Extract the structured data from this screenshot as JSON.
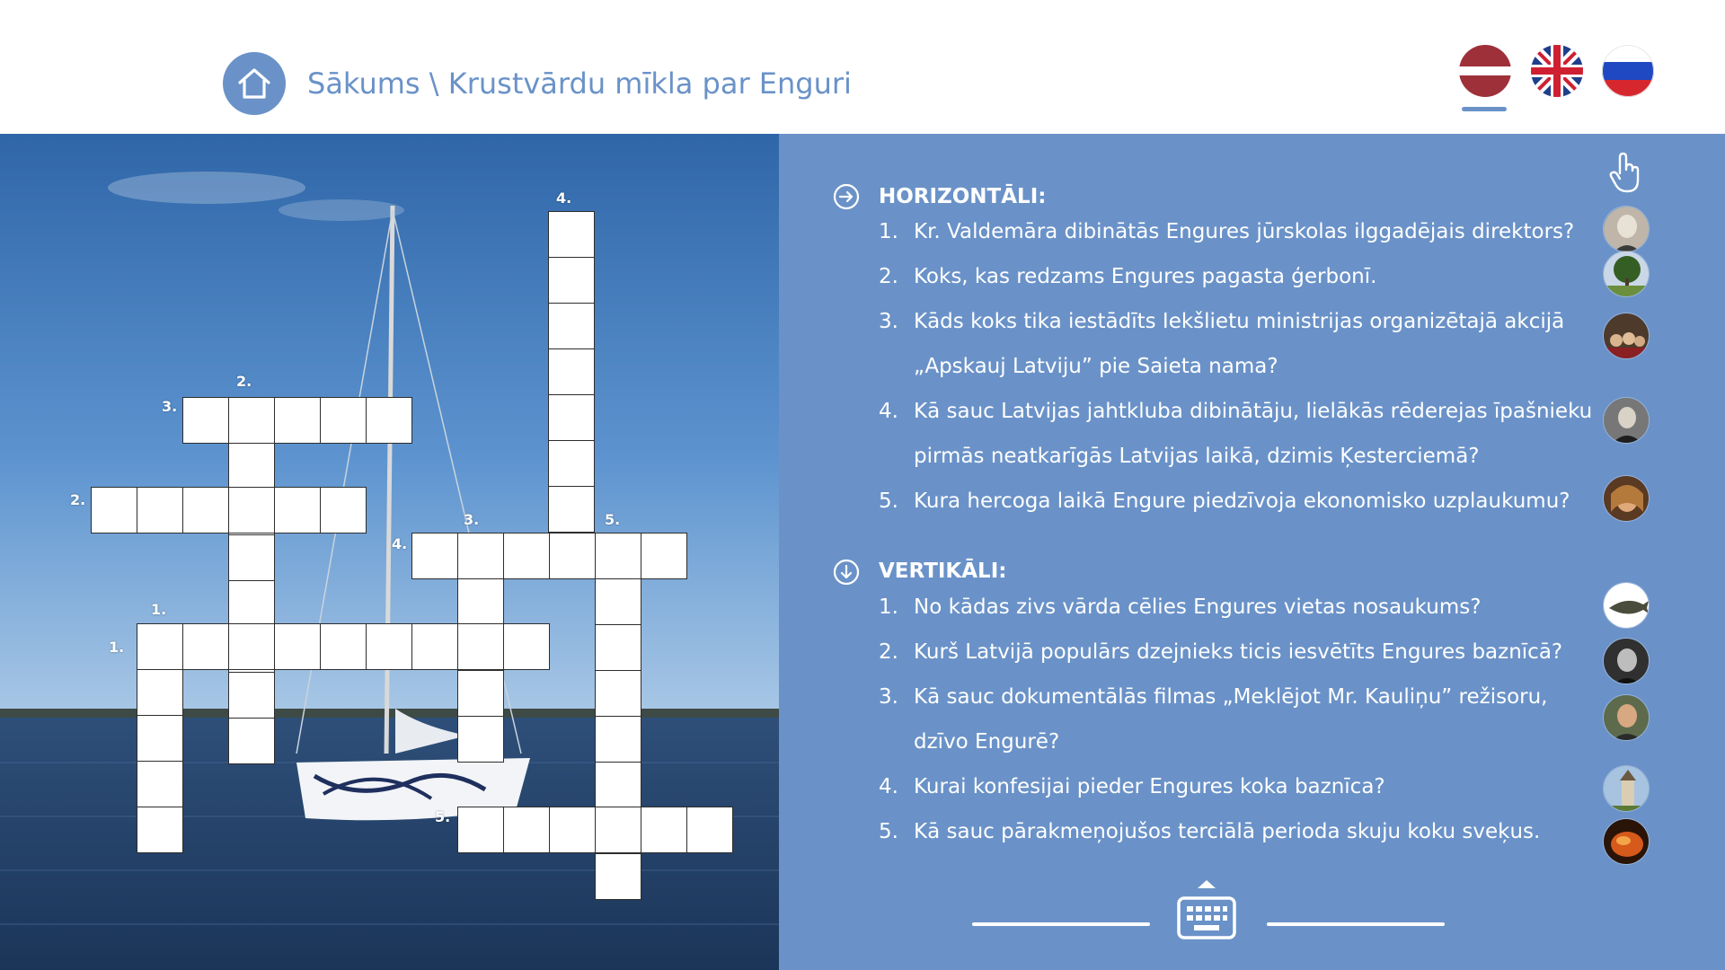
{
  "header": {
    "breadcrumb_home": "Sākums",
    "breadcrumb_sep": " \\ ",
    "breadcrumb_page": "Krustvārdu mīkla par Enguri",
    "languages": [
      "lv",
      "en",
      "ru"
    ],
    "active_language": "lv"
  },
  "colors": {
    "accent": "#6a92c8",
    "panel": "#6a92c8",
    "text_light": "#ffffff",
    "cell_border": "#2d2d2d"
  },
  "crossword": {
    "numbers": {
      "v4": "4.",
      "v2": "2.",
      "h3": "3.",
      "h2": "2.",
      "v3": "3.",
      "v5": "5.",
      "h4": "4.",
      "v1": "1.",
      "h1": "1.",
      "h5": "5."
    }
  },
  "clues": {
    "horizontal": {
      "title": "HORIZONTĀLI:",
      "items": [
        {
          "num": "1.",
          "lines": [
            "Kr. Valdemāra dibinātās Engures jūrskolas ilggadējais direktors?"
          ],
          "thumb": "portrait-elder"
        },
        {
          "num": "2.",
          "lines": [
            "Koks, kas redzams Engures pagasta ģerbonī."
          ],
          "thumb": "tree"
        },
        {
          "num": "3.",
          "lines": [
            "Kāds koks tika iestādīts Iekšlietu ministrijas organizētajā akcijā",
            "„Apskauj Latviju” pie Saieta nama?"
          ],
          "thumb": "group-photo"
        },
        {
          "num": "4.",
          "lines": [
            "Kā sauc Latvijas jahtkluba dibinātāju, lielākās rēderejas īpašnieku",
            "pirmās neatkarīgās Latvijas laikā, dzimis Ķesterciemā?"
          ],
          "thumb": "portrait-man"
        },
        {
          "num": "5.",
          "lines": [
            "Kura hercoga laikā Engure piedzīvoja ekonomisko uzplaukumu?"
          ],
          "thumb": "portrait-duke"
        }
      ]
    },
    "vertical": {
      "title": "VERTIKĀLI:",
      "items": [
        {
          "num": "1.",
          "lines": [
            "No kādas zivs vārda cēlies Engures vietas nosaukums?"
          ],
          "thumb": "fish"
        },
        {
          "num": "2.",
          "lines": [
            "Kurš Latvijā populārs dzejnieks ticis iesvētīts Engures baznīcā?"
          ],
          "thumb": "portrait-poet"
        },
        {
          "num": "3.",
          "lines": [
            "Kā sauc dokumentālās filmas „Meklējot Mr. Kauliņu” režisoru,",
            "dzīvo Engurē?"
          ],
          "thumb": "portrait-director"
        },
        {
          "num": "4.",
          "lines": [
            "Kurai konfesijai pieder Engures koka baznīca?"
          ],
          "thumb": "church"
        },
        {
          "num": "5.",
          "lines": [
            "Kā sauc pārakmeņojušos terciālā perioda skuju koku sveķus."
          ],
          "thumb": "amber"
        }
      ]
    }
  },
  "icons": {
    "home": "home-icon",
    "hand": "hand-pointer-icon",
    "keyboard": "keyboard-icon",
    "arrow_right": "circle-arrow-right-icon",
    "arrow_down": "circle-arrow-down-icon"
  }
}
